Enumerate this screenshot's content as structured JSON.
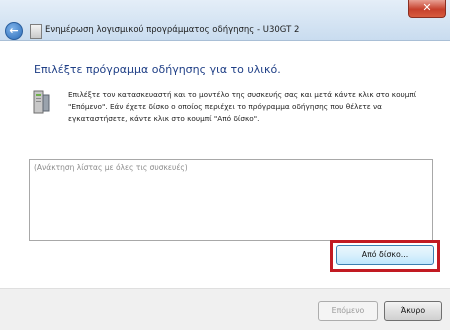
{
  "window": {
    "title": "Ενημέρωση λογισμικού προγράμματος οδήγησης - U30GT 2",
    "back_glyph": "←",
    "close_glyph": "✕"
  },
  "main": {
    "heading": "Επιλέξτε πρόγραμμα οδήγησης για το υλικό.",
    "description": "Επιλέξτε τον κατασκευαστή και το μοντέλο της συσκευής σας και μετά κάντε κλικ στο κουμπί \"Επόμενο\". Εάν έχετε δίσκο ο οποίος περιέχει το πρόγραμμα οδήγησης που θέλετε να εγκαταστήσετε, κάντε κλικ στο κουμπί \"Από δίσκο\".",
    "device_list_status": "(Ανάκτηση λίστας με όλες τις συσκευές)",
    "have_disk_label": "Από δίσκο...",
    "highlight_color": "#c21a22"
  },
  "footer": {
    "next_label": "Επόμενο",
    "cancel_label": "Άκυρο"
  },
  "icons": {
    "back": "back-arrow-icon",
    "app": "device-manager-icon",
    "device": "hardware-device-icon",
    "close": "close-icon"
  }
}
